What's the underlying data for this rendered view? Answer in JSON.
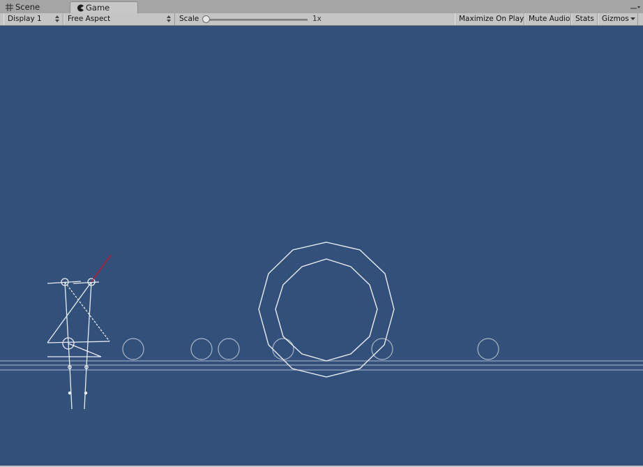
{
  "tabs": [
    {
      "label": "Scene",
      "icon": "grid-icon",
      "active": false
    },
    {
      "label": "Game",
      "icon": "pacman-icon",
      "active": true
    }
  ],
  "toolbar": {
    "display_label": "Display 1",
    "aspect_label": "Free Aspect",
    "scale_label": "Scale",
    "scale_value": "1x",
    "scale_level": 0,
    "maximize_label": "Maximize On Play",
    "mute_label": "Mute Audio",
    "stats_label": "Stats",
    "gizmos_label": "Gizmos"
  },
  "colors": {
    "game_background": "#325079",
    "gizmo_lines": "#e8edf5",
    "accent_line": "#c0182e"
  }
}
